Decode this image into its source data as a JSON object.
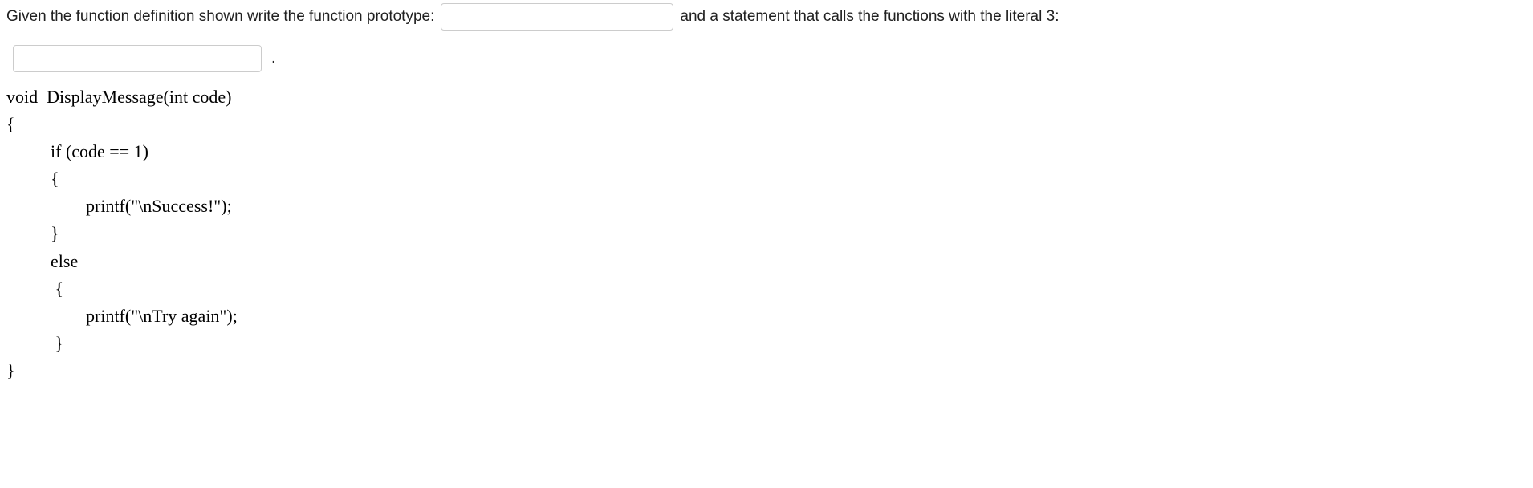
{
  "question": {
    "part1": "Given the function definition shown write the function prototype:",
    "part2": "and a statement that calls the functions with the literal 3:",
    "period": "."
  },
  "inputs": {
    "prototype_value": "",
    "call_value": ""
  },
  "code": {
    "line1": "void  DisplayMessage(int code)",
    "line2": "{",
    "line3": "          if (code == 1)",
    "line4": "          {",
    "line5": "                  printf(\"\\nSuccess!\");",
    "line6": "          }",
    "line7": "          else",
    "line8": "           {",
    "line9": "                  printf(\"\\nTry again\");",
    "line10": "           }",
    "line11": "}"
  }
}
